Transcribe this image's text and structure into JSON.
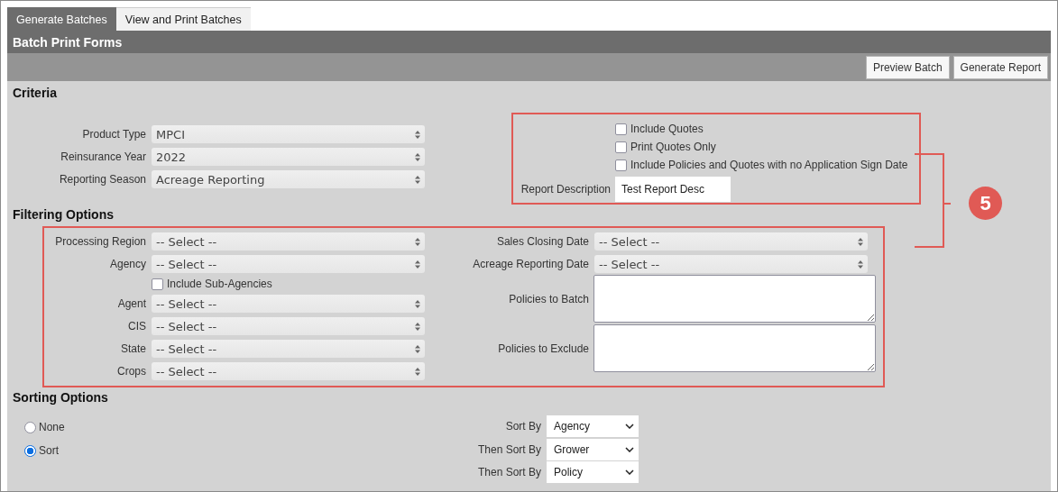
{
  "tabs": [
    {
      "label": "Generate Batches",
      "selected": true
    },
    {
      "label": "View and Print Batches",
      "selected": false
    }
  ],
  "panel": {
    "title": "Batch Print Forms"
  },
  "toolbar": {
    "buttons": [
      "Preview Batch",
      "Generate Report"
    ]
  },
  "criteria": {
    "heading": "Criteria",
    "fields": [
      {
        "label": "Product Type",
        "value": "MPCI"
      },
      {
        "label": "Reinsurance Year",
        "value": "2022"
      },
      {
        "label": "Reporting Season",
        "value": "Acreage Reporting"
      }
    ],
    "options": [
      {
        "label": "Include Quotes",
        "checked": false
      },
      {
        "label": "Print Quotes Only",
        "checked": false
      },
      {
        "label": "Include Policies and Quotes with no Application Sign Date",
        "checked": false
      }
    ],
    "report_description": {
      "label": "Report Description",
      "value": "Test Report Desc"
    }
  },
  "filtering": {
    "heading": "Filtering Options",
    "left": [
      {
        "kind": "select",
        "label": "Processing Region",
        "value": "-- Select --"
      },
      {
        "kind": "select",
        "label": "Agency",
        "value": "-- Select --"
      },
      {
        "kind": "checkbox",
        "label": "Include Sub-Agencies",
        "checked": false
      },
      {
        "kind": "select",
        "label": "Agent",
        "value": "-- Select --"
      },
      {
        "kind": "select",
        "label": "CIS",
        "value": "-- Select --"
      },
      {
        "kind": "select",
        "label": "State",
        "value": "-- Select --"
      },
      {
        "kind": "select",
        "label": "Crops",
        "value": "-- Select --"
      }
    ],
    "right": [
      {
        "kind": "select",
        "label": "Sales Closing Date",
        "value": "-- Select --"
      },
      {
        "kind": "select",
        "label": "Acreage Reporting Date",
        "value": "-- Select --"
      },
      {
        "kind": "textarea",
        "label": "Policies to Batch"
      },
      {
        "kind": "textarea",
        "label": "Policies to Exclude"
      }
    ]
  },
  "sorting": {
    "heading": "Sorting Options",
    "modes": [
      {
        "label": "None",
        "selected": false
      },
      {
        "label": "Sort",
        "selected": true
      }
    ],
    "sort_fields": [
      {
        "label": "Sort By",
        "value": "Agency"
      },
      {
        "label": "Then Sort By",
        "value": "Grower"
      },
      {
        "label": "Then Sort By",
        "value": "Policy"
      }
    ]
  },
  "callout": {
    "number": "5"
  }
}
